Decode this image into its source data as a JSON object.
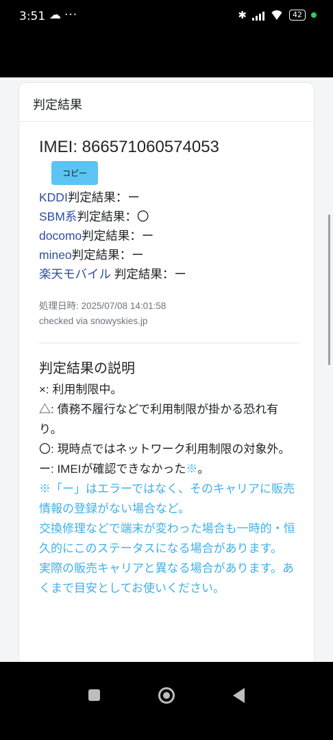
{
  "status_bar": {
    "time": "3:51",
    "more": "···",
    "battery": "42"
  },
  "card": {
    "title": "判定結果"
  },
  "imei": {
    "text": "IMEI: 866571060574053",
    "copy_label": "コピー"
  },
  "results": [
    {
      "carrier": "KDDI",
      "rest": "判定結果：ー"
    },
    {
      "carrier": "SBM系",
      "rest": "判定結果：〇"
    },
    {
      "carrier": "docomo",
      "rest": "判定結果：ー"
    },
    {
      "carrier": "mineo",
      "rest": "判定結果：ー"
    },
    {
      "carrier": "楽天モバイル",
      "rest": " 判定結果：ー"
    }
  ],
  "meta": {
    "processed": "処理日時: 2025/07/08 14:01:58",
    "checked": "checked via snowyskies.jp"
  },
  "explanation": {
    "title": "判定結果の説明",
    "lines": [
      "×: 利用制限中。",
      "△: 債務不履行などで利用制限が掛かる恐れ有り。",
      "〇: 現時点ではネットワーク利用制限の対象外。"
    ],
    "line4_text": "ー: IMEIが確認できなかった",
    "line4_mark": "※",
    "line4_end": "。",
    "notes": [
      "※「ー」はエラーではなく、そのキャリアに販売情報の登録がない場合など。",
      "交換修理などで端末が変わった場合も一時的・恒久的にこのステータスになる場合があります。",
      "実際の販売キャリアと異なる場合があります。あくまで目安としてお使いください。"
    ]
  }
}
